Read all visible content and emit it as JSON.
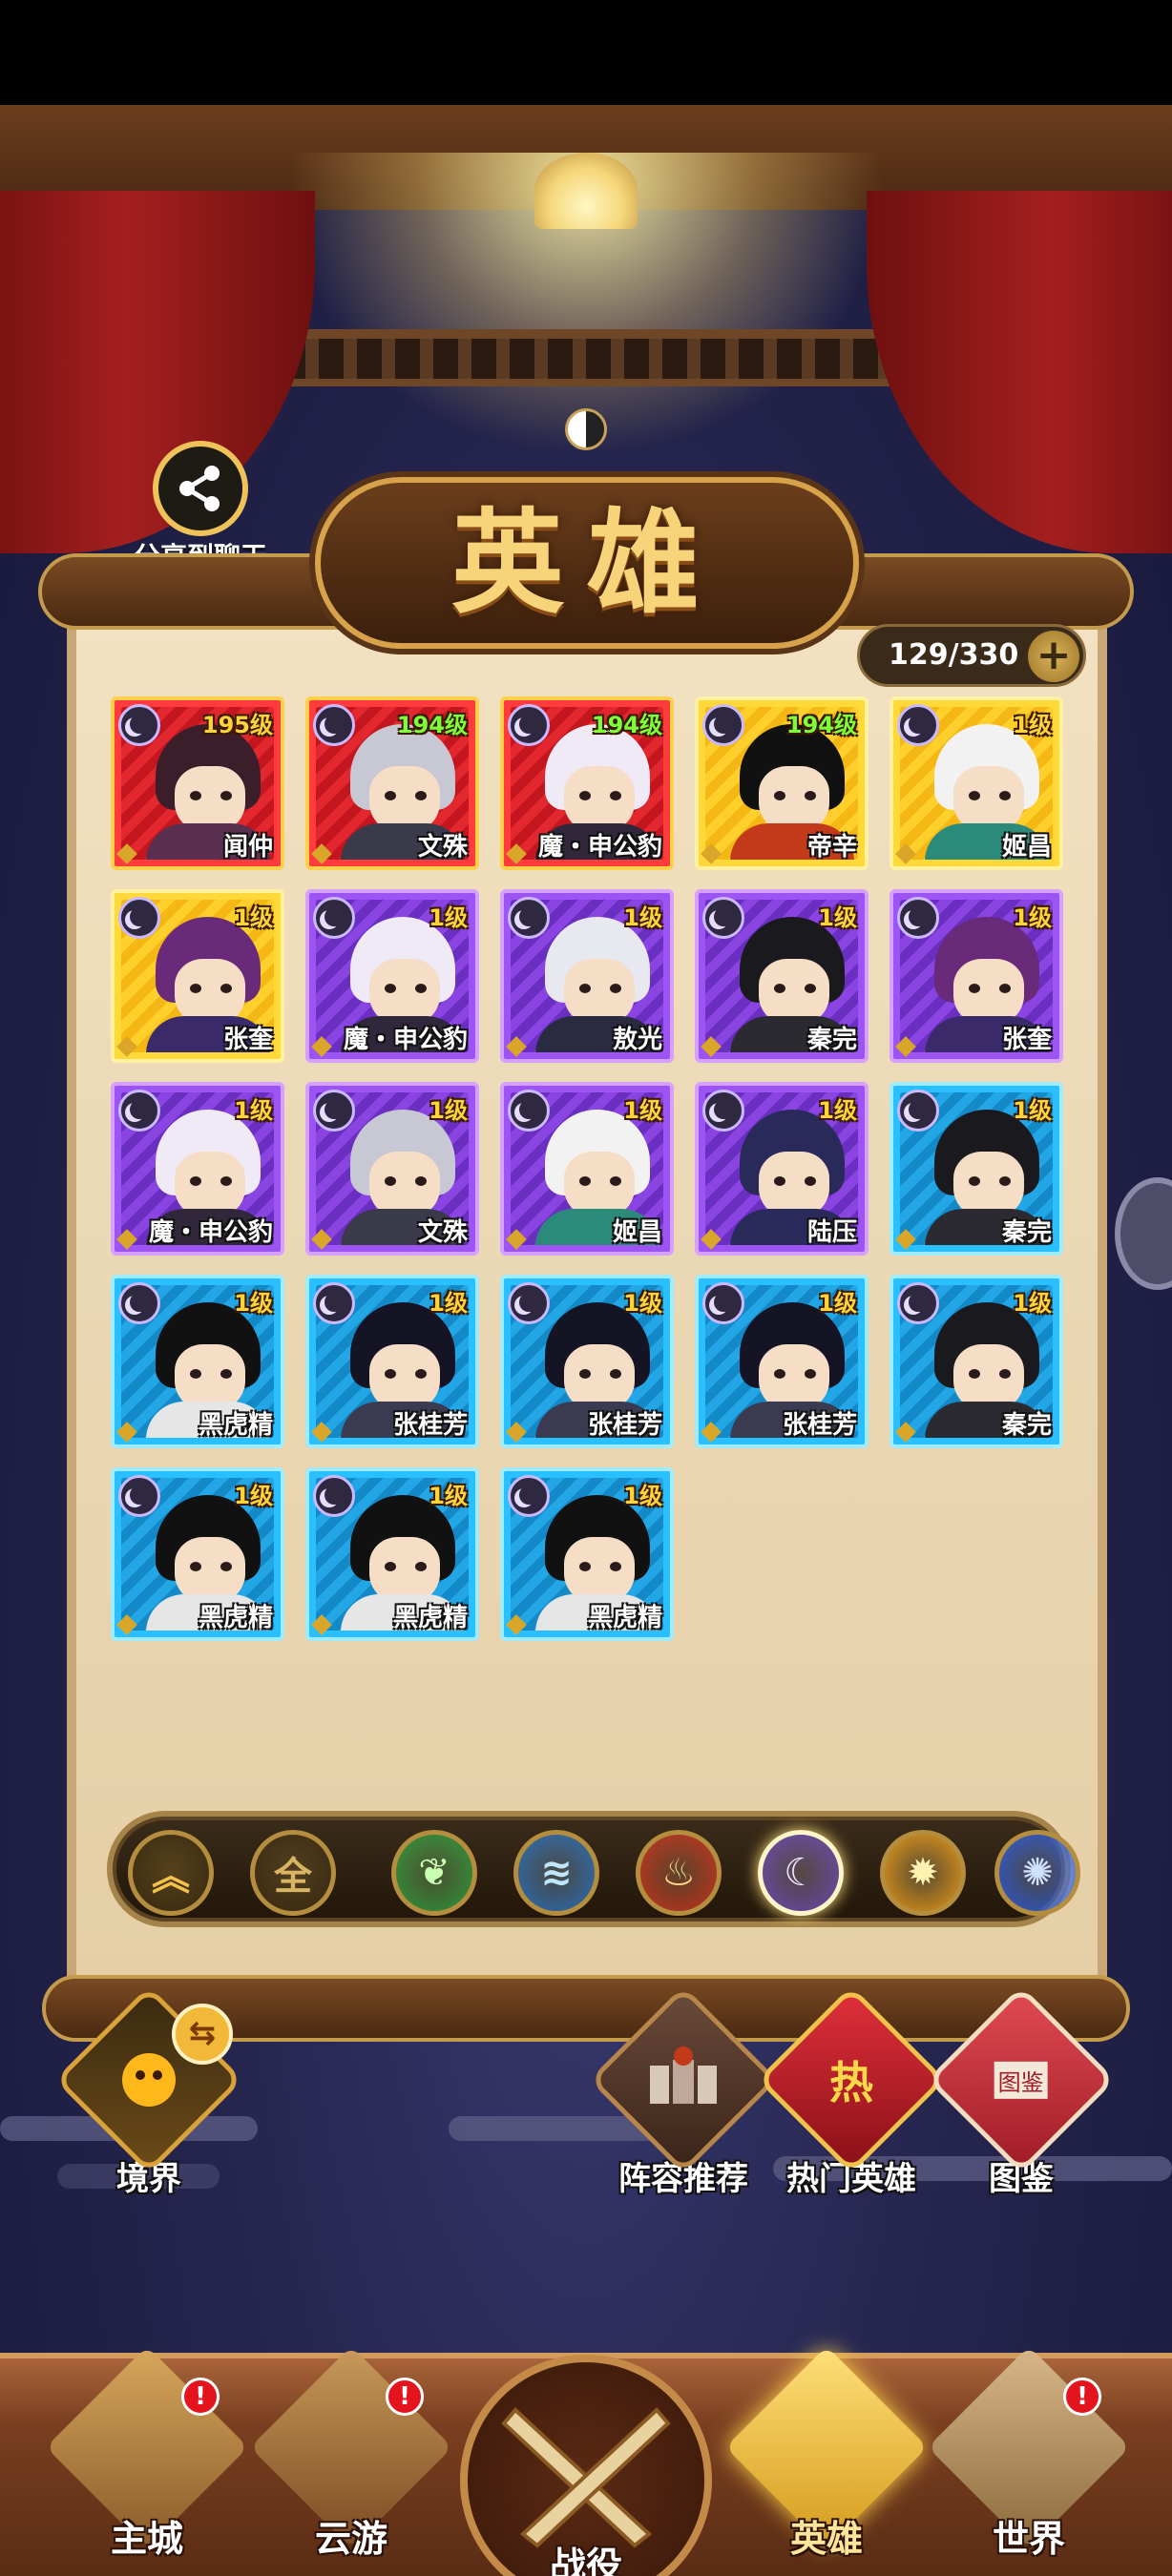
{
  "share": {
    "label": "分享到聊天",
    "icon": "share-icon"
  },
  "title": "英雄",
  "counter": {
    "value": "129/330",
    "plus": "+"
  },
  "heroes": [
    {
      "name": "闻仲",
      "level": "195级",
      "rarity": "red",
      "level_color": "gold",
      "hair": "#3b1e2a",
      "body": "#5a3050"
    },
    {
      "name": "文殊",
      "level": "194级",
      "rarity": "red",
      "level_color": "green",
      "hair": "#c8c8d4",
      "body": "#3a3a4a"
    },
    {
      "name": "魔・申公豹",
      "level": "194级",
      "rarity": "red",
      "level_color": "green",
      "hair": "#efeaf6",
      "body": "#30283a"
    },
    {
      "name": "帝辛",
      "level": "194级",
      "rarity": "gold",
      "level_color": "green",
      "hair": "#111111",
      "body": "#c23a1a"
    },
    {
      "name": "姬昌",
      "level": "1级",
      "rarity": "gold",
      "level_color": "gold",
      "hair": "#f2f2f2",
      "body": "#2c8a7a"
    },
    {
      "name": "张奎",
      "level": "1级",
      "rarity": "gold",
      "level_color": "gold",
      "hair": "#6a2a7a",
      "body": "#3a2a6a"
    },
    {
      "name": "魔・申公豹",
      "level": "1级",
      "rarity": "purple",
      "level_color": "gold",
      "hair": "#efeaf6",
      "body": "#30283a"
    },
    {
      "name": "敖光",
      "level": "1级",
      "rarity": "purple",
      "level_color": "gold",
      "hair": "#e8e8f0",
      "body": "#2a2a40"
    },
    {
      "name": "秦完",
      "level": "1级",
      "rarity": "purple",
      "level_color": "gold",
      "hair": "#1a1a1e",
      "body": "#2a2a30"
    },
    {
      "name": "张奎",
      "level": "1级",
      "rarity": "purple",
      "level_color": "gold",
      "hair": "#6a2a7a",
      "body": "#3a2a6a"
    },
    {
      "name": "魔・申公豹",
      "level": "1级",
      "rarity": "purple",
      "level_color": "gold",
      "hair": "#efeaf6",
      "body": "#30283a"
    },
    {
      "name": "文殊",
      "level": "1级",
      "rarity": "purple",
      "level_color": "gold",
      "hair": "#c8c8d4",
      "body": "#3a3a4a"
    },
    {
      "name": "姬昌",
      "level": "1级",
      "rarity": "purple",
      "level_color": "gold",
      "hair": "#f2f2f2",
      "body": "#2c8a7a"
    },
    {
      "name": "陆压",
      "level": "1级",
      "rarity": "purple",
      "level_color": "gold",
      "hair": "#2a2a5a",
      "body": "#2a2a5a"
    },
    {
      "name": "秦完",
      "level": "1级",
      "rarity": "blue",
      "level_color": "gold",
      "hair": "#1a1a1e",
      "body": "#2a2a30"
    },
    {
      "name": "黑虎精",
      "level": "1级",
      "rarity": "blue",
      "level_color": "gold",
      "hair": "#111111",
      "body": "#e6e6e6"
    },
    {
      "name": "张桂芳",
      "level": "1级",
      "rarity": "blue",
      "level_color": "gold",
      "hair": "#141424",
      "body": "#3a3a50"
    },
    {
      "name": "张桂芳",
      "level": "1级",
      "rarity": "blue",
      "level_color": "gold",
      "hair": "#141424",
      "body": "#3a3a50"
    },
    {
      "name": "张桂芳",
      "level": "1级",
      "rarity": "blue",
      "level_color": "gold",
      "hair": "#141424",
      "body": "#3a3a50"
    },
    {
      "name": "秦完",
      "level": "1级",
      "rarity": "blue",
      "level_color": "gold",
      "hair": "#1a1a1e",
      "body": "#2a2a30"
    },
    {
      "name": "黑虎精",
      "level": "1级",
      "rarity": "blue",
      "level_color": "gold",
      "hair": "#111111",
      "body": "#e6e6e6"
    },
    {
      "name": "黑虎精",
      "level": "1级",
      "rarity": "blue",
      "level_color": "gold",
      "hair": "#111111",
      "body": "#e6e6e6"
    },
    {
      "name": "黑虎精",
      "level": "1级",
      "rarity": "blue",
      "level_color": "gold",
      "hair": "#111111",
      "body": "#e6e6e6"
    }
  ],
  "filters": [
    {
      "name": "sort-quality-icon",
      "label": "",
      "glyph": "︽",
      "bg": "#3a2a10",
      "fg": "#f2c24a",
      "selected": false
    },
    {
      "name": "all-filter-button",
      "label": "全",
      "glyph": "全",
      "bg": "#3a2a10",
      "fg": "#d9b462",
      "selected": false
    },
    {
      "name": "wood-element-icon",
      "label": "",
      "glyph": "❦",
      "bg": "#2f9a3a",
      "fg": "#c8ffb0",
      "selected": false
    },
    {
      "name": "water-element-icon",
      "label": "",
      "glyph": "≋",
      "bg": "#2a6fb8",
      "fg": "#bfe6ff",
      "selected": false
    },
    {
      "name": "fire-element-icon",
      "label": "",
      "glyph": "♨",
      "bg": "#c8321e",
      "fg": "#ffd28a",
      "selected": false
    },
    {
      "name": "moon-element-icon",
      "label": "",
      "glyph": "☾",
      "bg": "#6a4ab0",
      "fg": "#f0e6ff",
      "selected": true
    },
    {
      "name": "sun-element-icon",
      "label": "",
      "glyph": "✹",
      "bg": "#e89a18",
      "fg": "#fff1b0",
      "selected": false
    },
    {
      "name": "vortex-element-icon",
      "label": "",
      "glyph": "✺",
      "bg": "#2a5ad8",
      "fg": "#cfe0ff",
      "selected": false
    }
  ],
  "actions": {
    "realm": "境界",
    "lineup": "阵容推荐",
    "hot_heroes": "热门英雄",
    "hot_badge": "热",
    "codex": "图鉴",
    "codex_book": "图鉴"
  },
  "nav": {
    "city": "主城",
    "travel": "云游",
    "battle": "战役",
    "heroes": "英雄",
    "world": "世界",
    "badge": "!"
  },
  "colors": {
    "accent_gold": "#f7d37a",
    "rarity_red": "#ff3b3b",
    "rarity_gold": "#ffd93a",
    "rarity_purple": "#9c54f2",
    "rarity_blue": "#2ac0ff"
  }
}
